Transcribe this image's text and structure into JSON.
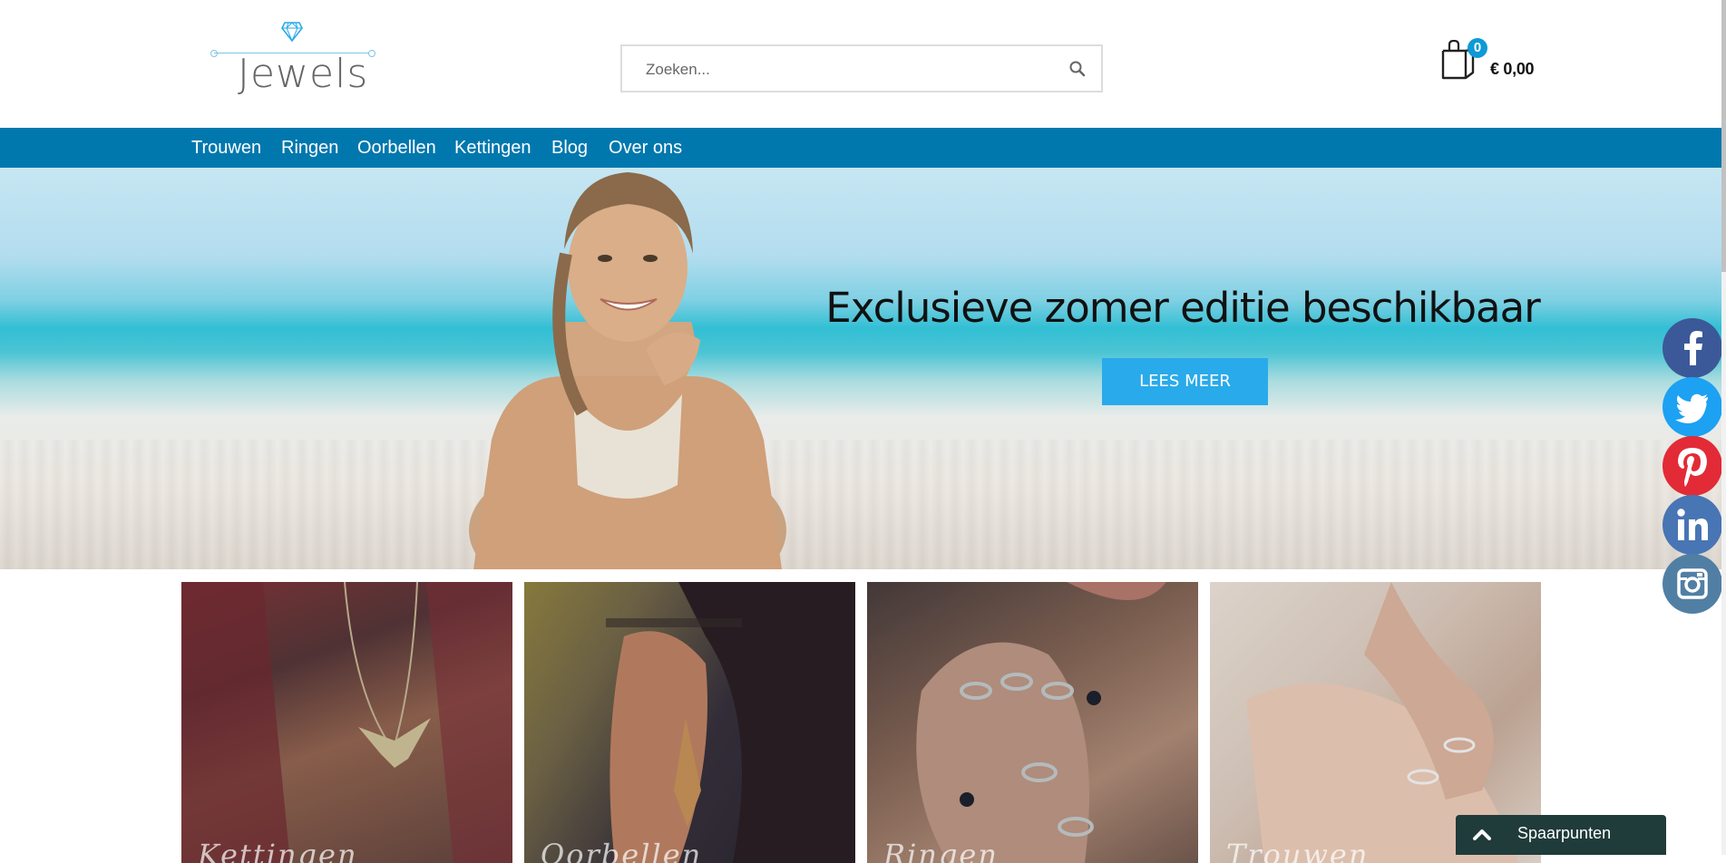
{
  "logo": {
    "text": "Jewels",
    "icon": "diamond-icon"
  },
  "search": {
    "placeholder": "Zoeken...",
    "value": "",
    "icon": "search-icon"
  },
  "cart": {
    "count": "0",
    "total": "€ 0,00",
    "icon": "shopping-bag-icon"
  },
  "nav": {
    "items": [
      {
        "label": "Trouwen"
      },
      {
        "label": "Ringen"
      },
      {
        "label": "Oorbellen"
      },
      {
        "label": "Kettingen"
      },
      {
        "label": "Blog"
      },
      {
        "label": "Over ons"
      }
    ]
  },
  "hero": {
    "heading": "Exclusieve zomer editie beschikbaar",
    "button": "LEES MEER"
  },
  "tiles": [
    {
      "caption": "Kettingen"
    },
    {
      "caption": "Oorbellen"
    },
    {
      "caption": "Ringen"
    },
    {
      "caption": "Trouwen"
    }
  ],
  "social": [
    {
      "icon": "facebook-icon",
      "color": "#3b5998"
    },
    {
      "icon": "twitter-icon",
      "color": "#1da1f2"
    },
    {
      "icon": "pinterest-icon",
      "color": "#e22b36"
    },
    {
      "icon": "linkedin-icon",
      "color": "#4875b4"
    },
    {
      "icon": "instagram-icon",
      "color": "#517fa4"
    }
  ],
  "widget": {
    "label": "Spaarpunten"
  },
  "colors": {
    "nav": "#0078ae",
    "accent": "#29aaeb",
    "badge": "#0d9ad6",
    "widget": "#1f3b3a"
  }
}
